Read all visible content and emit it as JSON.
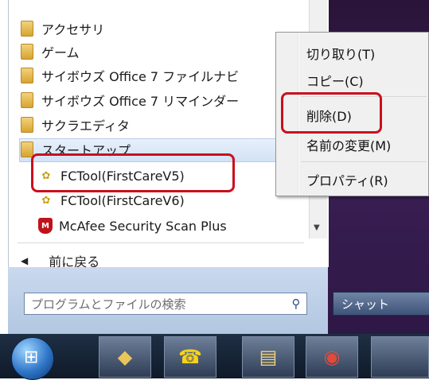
{
  "start_menu": {
    "programs": [
      {
        "label": "アクセサリ",
        "icon": "folder-icon"
      },
      {
        "label": "ゲーム",
        "icon": "folder-icon"
      },
      {
        "label": "サイボウズ Office 7 ファイルナビ",
        "icon": "folder-icon"
      },
      {
        "label": "サイボウズ Office 7 リマインダー",
        "icon": "folder-icon"
      },
      {
        "label": "サクラエディタ",
        "icon": "folder-icon"
      },
      {
        "label": "スタートアップ",
        "icon": "folder-icon"
      }
    ],
    "startup_items": [
      {
        "label": "FCTool(FirstCareV5)",
        "icon": "fctool-icon"
      },
      {
        "label": "FCTool(FirstCareV6)",
        "icon": "fctool-icon"
      },
      {
        "label": "McAfee Security Scan Plus",
        "icon": "mcafee-shield-icon"
      }
    ],
    "back_label": "前に戻る",
    "search_placeholder": "プログラムとファイルの検索",
    "shutdown_label": "シャット"
  },
  "context_menu": {
    "items": [
      {
        "label": "切り取り(T)"
      },
      {
        "label": "コピー(C)"
      },
      {
        "label": "削除(D)"
      },
      {
        "label": "名前の変更(M)"
      },
      {
        "label": "プロパティ(R)"
      }
    ]
  },
  "taskbar": {
    "buttons": [
      "windows-explorer-icon",
      "phone-icon",
      "file-manager-icon",
      "chrome-icon"
    ]
  },
  "highlight_color": "#c9101d"
}
